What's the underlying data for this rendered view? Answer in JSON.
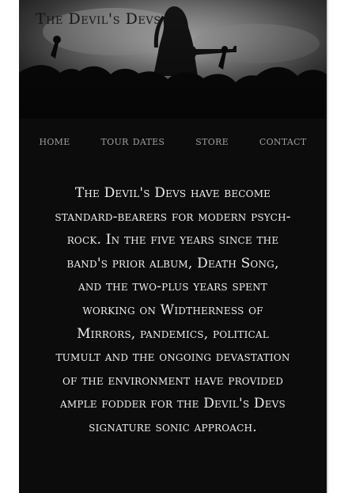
{
  "header": {
    "title": "The Devil's Devs"
  },
  "nav": {
    "items": [
      {
        "label": "Home"
      },
      {
        "label": "Tour Dates"
      },
      {
        "label": "Store"
      },
      {
        "label": "Contact"
      }
    ]
  },
  "main": {
    "bio": "The Devil's Devs have become standard-bearers for modern psych-rock. In the five years since the band's prior album, Death Song, and the two-plus years spent working on Widtherness of Mirrors, pandemics, political tumult and the ongoing devastation of the environment have provided ample fodder for the Devil's Devs signature sonic approach."
  },
  "colors": {
    "page_background": "#0d0c0c",
    "nav_text": "#9e9e9e",
    "body_text": "#ededed"
  }
}
